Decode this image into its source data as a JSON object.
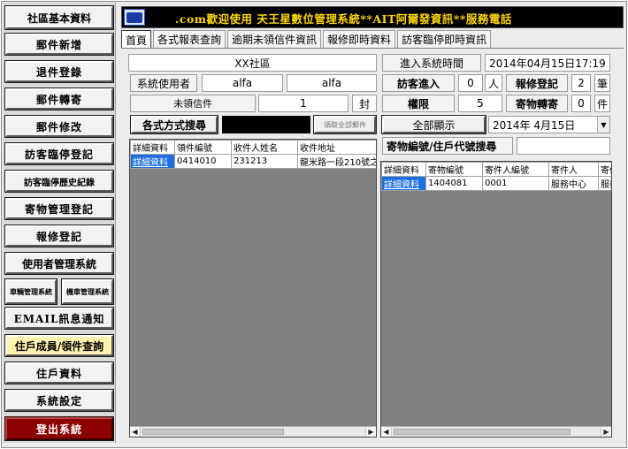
{
  "sidebar": {
    "title": "社區基本資料",
    "items": [
      {
        "label": "郵件新增"
      },
      {
        "label": "退件登錄"
      },
      {
        "label": "郵件轉寄"
      },
      {
        "label": "郵件修改"
      },
      {
        "label": "訪客臨停登記"
      },
      {
        "label": "訪客臨停歷史紀錄"
      },
      {
        "label": "寄物管理登記"
      },
      {
        "label": "報修登記"
      },
      {
        "label": "使用者管理系統"
      },
      {
        "label": "車輛管理系統"
      },
      {
        "label": "機車管理系統"
      },
      {
        "label": "EMAIL訊息通知"
      },
      {
        "label": "住戶成員/領件查詢"
      },
      {
        "label": "住戶資料"
      },
      {
        "label": "系統設定"
      },
      {
        "label": "登出系統"
      }
    ]
  },
  "header": {
    "logo_icon": "company-logo-icon",
    "marquee": ".com歡迎使用 天王星數位管理系統**AIT阿爾發資訊**服務電話"
  },
  "tabs": [
    {
      "label": "首頁",
      "active": true
    },
    {
      "label": "各式報表查詢"
    },
    {
      "label": "逾期未領信件資訊"
    },
    {
      "label": "報修即時資料"
    },
    {
      "label": "訪客臨停即時資訊"
    }
  ],
  "info": {
    "community": "XX社區",
    "system_user_label": "系統使用者",
    "user_id": "alfa",
    "user_name": "alfa",
    "unclaimed_label": "未領信件",
    "unclaimed_count": "1",
    "unclaimed_unit": "封",
    "login_time_label": "進入系統時間",
    "login_time": "2014年04月15日17:19",
    "visitor_label": "訪客進入",
    "visitor_count": "0",
    "visitor_unit": "人",
    "repair_label": "報修登記",
    "repair_count": "2",
    "repair_unit": "筆",
    "permission_label": "權限",
    "permission_value": "5",
    "forward_label": "寄物轉寄",
    "forward_count": "0",
    "forward_unit": "件"
  },
  "left_panel": {
    "search_button": "各式方式搜尋",
    "search_value": "",
    "take_all_button": "領取全部郵件",
    "columns": [
      "詳細資料",
      "領件編號",
      "收件人姓名",
      "收件地址"
    ],
    "rows": [
      [
        "詳細資料",
        "0414010",
        "231213",
        "龍米路一段210號之"
      ]
    ]
  },
  "right_panel": {
    "show_all_button": "全部顯示",
    "date_select": "2014年 4月15日",
    "search_label": "寄物編號/住戶代號搜尋",
    "search_value": "",
    "columns": [
      "詳細資料",
      "寄物編號",
      "寄件人編號",
      "寄件人",
      "寄件"
    ],
    "rows": [
      [
        "詳細資料",
        "1404081",
        "0001",
        "服務中心",
        "服務"
      ]
    ]
  }
}
